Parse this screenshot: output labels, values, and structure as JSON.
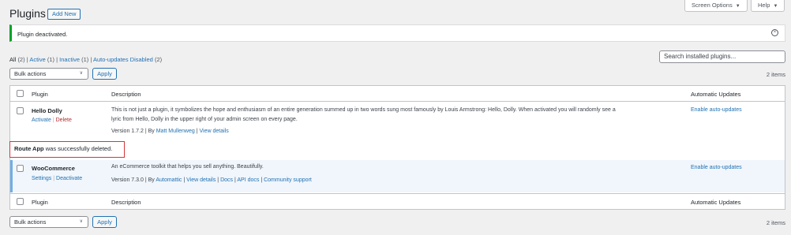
{
  "header": {
    "title": "Plugins",
    "add_new": "Add New",
    "screen_options": "Screen Options",
    "help": "Help"
  },
  "notice": {
    "message": "Plugin deactivated."
  },
  "filters": {
    "all": "All",
    "all_count": "(2)",
    "active": "Active",
    "active_count": "(1)",
    "inactive": "Inactive",
    "inactive_count": "(1)",
    "auto_updates_disabled": "Auto-updates Disabled",
    "auto_updates_disabled_count": "(2)"
  },
  "search": {
    "placeholder": "Search installed plugins..."
  },
  "tablenav": {
    "bulk_actions": "Bulk actions",
    "apply": "Apply",
    "count": "2 items"
  },
  "columns": {
    "plugin": "Plugin",
    "description": "Description",
    "auto_updates": "Automatic Updates"
  },
  "plugins": [
    {
      "name": "Hello Dolly",
      "action_1": "Activate",
      "action_2": "Delete",
      "description_line_1": "This is not just a plugin, it symbolizes the hope and enthusiasm of an entire generation summed up in two words sung most famously by Louis Armstrong: Hello, Dolly. When activated you will randomly see a",
      "description_line_2": "lyric from Hello, Dolly in the upper right of your admin screen on every page.",
      "version": "Version 1.7.2",
      "by": "By",
      "author": "Matt Mullenweg",
      "link_1": "View details",
      "auto_update": "Enable auto-updates"
    },
    {
      "name": "WooCommerce",
      "action_1": "Settings",
      "action_2": "Deactivate",
      "description_line_1": "An eCommerce toolkit that helps you sell anything. Beautifully.",
      "version": "Version 7.3.0",
      "by": "By",
      "author": "Automattic",
      "link_1": "View details",
      "link_2": "Docs",
      "link_3": "API docs",
      "link_4": "Community support",
      "auto_update": "Enable auto-updates"
    }
  ],
  "deleted_notice": {
    "name": "Route App",
    "message": "was successfully deleted."
  },
  "colors": {
    "accent": "#2271b1",
    "success": "#00a32a",
    "danger": "#d63638",
    "active_row": "#f0f6fc"
  }
}
